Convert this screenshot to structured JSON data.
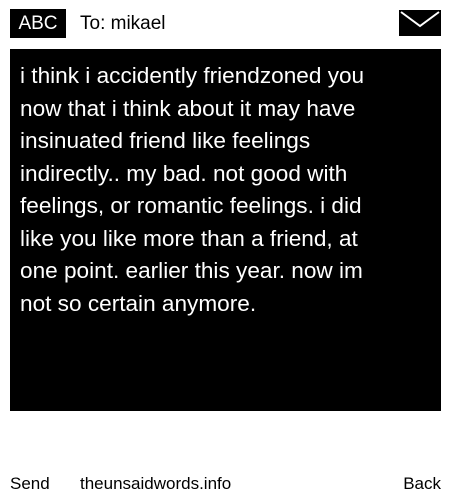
{
  "header": {
    "mode": "ABC",
    "recipient": "To: mikael",
    "icon": "envelope-icon"
  },
  "message": {
    "text": "i think i accidently friendzoned you\nnow that i think about it may have\ninsinuated friend like feelings\nindirectly.. my bad. not good with\nfeelings, or romantic feelings.  i did\nlike you like more than a friend, at\none point. earlier this year. now im\nnot so certain anymore."
  },
  "footer": {
    "send_label": "Send",
    "site_label": "theunsaidwords.info",
    "back_label": "Back"
  },
  "colors": {
    "background": "#ffffff",
    "message_bg": "#000000",
    "message_text": "#ffffff",
    "text": "#000000"
  }
}
